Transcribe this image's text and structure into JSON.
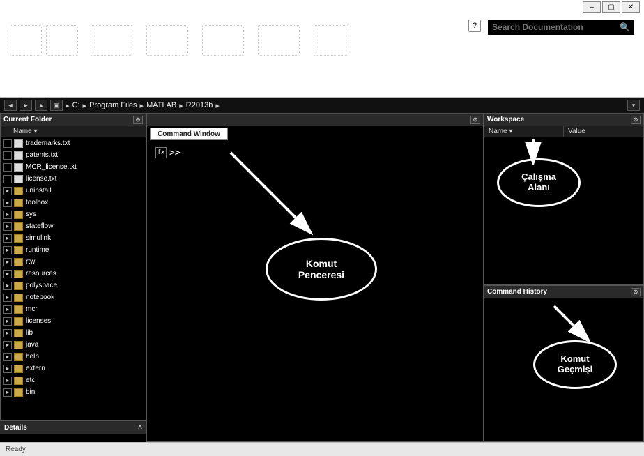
{
  "window_controls": {
    "min": "–",
    "max": "▢",
    "close": "✕"
  },
  "search": {
    "placeholder": "Search Documentation"
  },
  "help_label": "?",
  "address": {
    "segs": [
      "C:",
      "Program Files",
      "MATLAB",
      "R2013b"
    ]
  },
  "panels": {
    "current_folder": {
      "title": "Current Folder",
      "col_name": "Name ▾",
      "details_title": "Details"
    },
    "command_window": {
      "title": "Command Window",
      "prompt": ">>"
    },
    "workspace": {
      "title": "Workspace",
      "col_name": "Name ▾",
      "col_value": "Value"
    },
    "command_history": {
      "title": "Command History"
    }
  },
  "files": [
    {
      "type": "file",
      "label": "trademarks.txt"
    },
    {
      "type": "file",
      "label": "patents.txt"
    },
    {
      "type": "file",
      "label": "MCR_license.txt"
    },
    {
      "type": "file",
      "label": "license.txt"
    },
    {
      "type": "folder",
      "label": "uninstall"
    },
    {
      "type": "folder",
      "label": "toolbox"
    },
    {
      "type": "folder",
      "label": "sys"
    },
    {
      "type": "folder",
      "label": "stateflow"
    },
    {
      "type": "folder",
      "label": "simulink"
    },
    {
      "type": "folder",
      "label": "runtime"
    },
    {
      "type": "folder",
      "label": "rtw"
    },
    {
      "type": "folder",
      "label": "resources"
    },
    {
      "type": "folder",
      "label": "polyspace"
    },
    {
      "type": "folder",
      "label": "notebook"
    },
    {
      "type": "folder",
      "label": "mcr"
    },
    {
      "type": "folder",
      "label": "licenses"
    },
    {
      "type": "folder",
      "label": "lib"
    },
    {
      "type": "folder",
      "label": "java"
    },
    {
      "type": "folder",
      "label": "help"
    },
    {
      "type": "folder",
      "label": "extern"
    },
    {
      "type": "folder",
      "label": "etc"
    },
    {
      "type": "folder",
      "label": "bin"
    }
  ],
  "annotations": {
    "cmd": "Komut\nPenceresi",
    "ws": "Çalışma\nAlanı",
    "hist": "Komut\nGeçmişi"
  },
  "status": {
    "ready": "Ready"
  }
}
